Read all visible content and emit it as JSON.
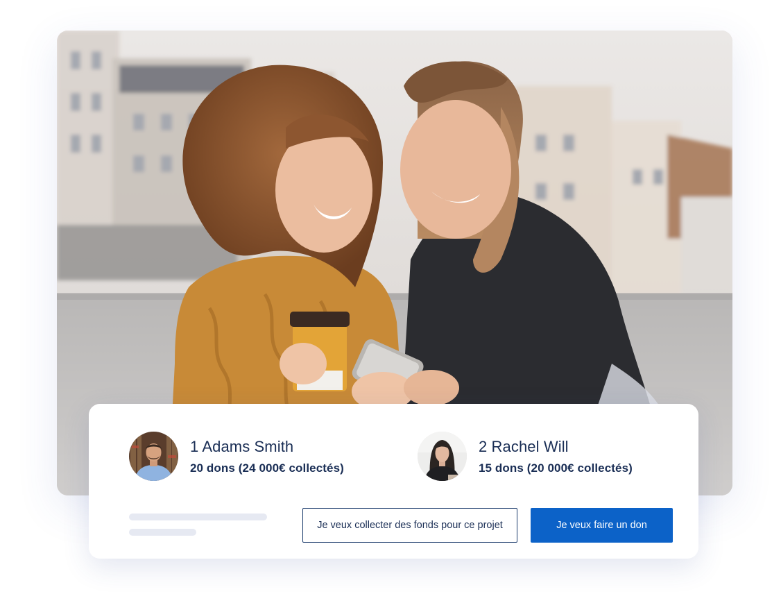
{
  "hero": {
    "image_description_icon": "photo-two-women-with-phone"
  },
  "donors": [
    {
      "name": "1 Adams Smith",
      "stats": "20 dons (24 000€ collectés)",
      "avatar_icon": "avatar-man-icon"
    },
    {
      "name": "2 Rachel Will",
      "stats": "15 dons (20 000€ collectés)",
      "avatar_icon": "avatar-woman-icon"
    }
  ],
  "actions": {
    "collect_label": "Je veux collecter des fonds pour ce projet",
    "donate_label": "Je veux faire un don"
  },
  "colors": {
    "primary": "#0c62c8",
    "text_dark": "#1a2e55",
    "skeleton": "#e6e9f2"
  }
}
